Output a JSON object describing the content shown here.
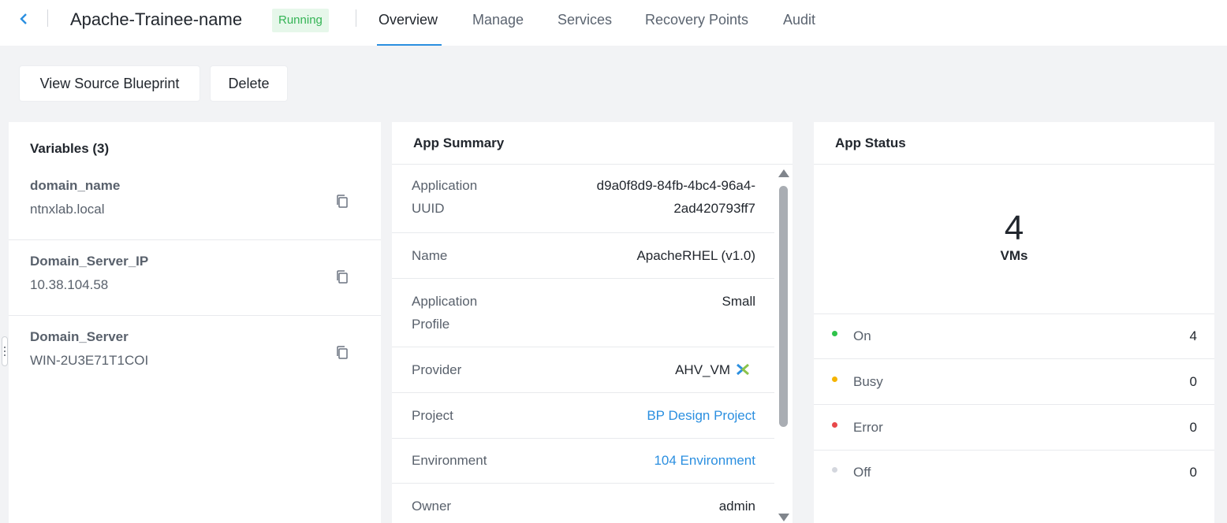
{
  "header": {
    "title": "Apache-Trainee-name",
    "status": "Running",
    "tabs": [
      {
        "label": "Overview",
        "active": true
      },
      {
        "label": "Manage"
      },
      {
        "label": "Services"
      },
      {
        "label": "Recovery Points"
      },
      {
        "label": "Audit"
      }
    ]
  },
  "actions": {
    "view_blueprint": "View Source Blueprint",
    "delete": "Delete"
  },
  "variables": {
    "title": "Variables (3)",
    "items": [
      {
        "name": "domain_name",
        "value": "ntnxlab.local"
      },
      {
        "name": "Domain_Server_IP",
        "value": "10.38.104.58"
      },
      {
        "name": "Domain_Server",
        "value": "WIN-2U3E71T1COI"
      }
    ]
  },
  "summary": {
    "title": "App Summary",
    "uuid_label": "Application UUID",
    "uuid_line1": "d9a0f8d9-84fb-4bc4-96a4-",
    "uuid_line2": "2ad420793ff7",
    "name_label": "Name",
    "name_value": "ApacheRHEL (v1.0)",
    "profile_label": "Application Profile",
    "profile_value": "Small",
    "provider_label": "Provider",
    "provider_value": "AHV_VM",
    "project_label": "Project",
    "project_value": "BP Design Project",
    "environment_label": "Environment",
    "environment_value": "104 Environment",
    "owner_label": "Owner",
    "owner_value": "admin"
  },
  "status_panel": {
    "title": "App Status",
    "vm_count": "4",
    "vm_label": "VMs",
    "states": [
      {
        "label": "On",
        "count": "4",
        "color": "#2ec34a"
      },
      {
        "label": "Busy",
        "count": "0",
        "color": "#f5b400"
      },
      {
        "label": "Error",
        "count": "0",
        "color": "#e8484a"
      },
      {
        "label": "Off",
        "count": "0",
        "color": "#d4d7de"
      }
    ]
  },
  "colors": {
    "accent": "#2b8fe0",
    "running_text": "#34b455",
    "running_bg": "#e6f7ea"
  }
}
